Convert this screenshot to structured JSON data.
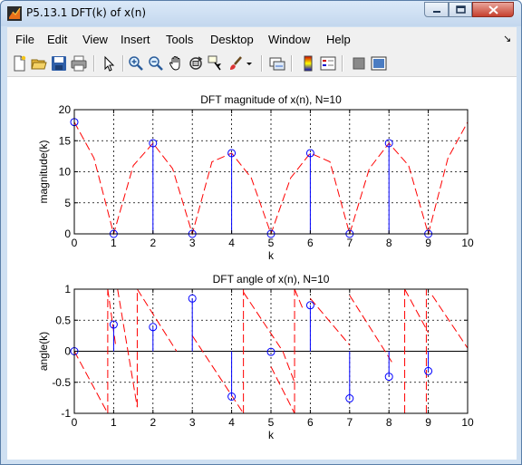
{
  "window": {
    "title": "P5.13.1 DFT(k) of x(n)",
    "menus": [
      "File",
      "Edit",
      "View",
      "Insert",
      "Tools",
      "Desktop",
      "Window",
      "Help"
    ],
    "dock_glyph": "↘"
  },
  "toolbar": {
    "icons": [
      "new-figure-icon",
      "open-file-icon",
      "save-icon",
      "print-icon",
      "edit-plot-arrow-icon",
      "zoom-in-icon",
      "zoom-out-icon",
      "pan-hand-icon",
      "rotate-3d-icon",
      "data-cursor-icon",
      "brush-icon",
      "brush-dropdown-icon",
      "link-plot-icon",
      "colorbar-icon",
      "legend-icon",
      "hide-plot-tools-icon",
      "show-plot-tools-icon"
    ]
  },
  "colors": {
    "stem": "#0000ff",
    "curve": "#ff0000",
    "grid": "#000000",
    "background": "#ffffff"
  },
  "chart_data": [
    {
      "type": "line",
      "title": "DFT magnitude of x(n), N=10",
      "xlabel": "k",
      "ylabel": "magnitude(k)",
      "xlim": [
        0,
        10
      ],
      "ylim": [
        0,
        20
      ],
      "xticks": [
        "0",
        "1",
        "2",
        "3",
        "4",
        "5",
        "6",
        "7",
        "8",
        "9",
        "10"
      ],
      "yticks": [
        "0",
        "5",
        "10",
        "15",
        "20"
      ],
      "grid": true,
      "series": [
        {
          "style": "stem",
          "color": "#0000ff",
          "marker": "circle",
          "x": [
            0,
            1,
            2,
            3,
            4,
            5,
            6,
            7,
            8,
            9
          ],
          "y": [
            18.0,
            0.0,
            14.6,
            0.0,
            13.0,
            0.0,
            13.0,
            0.0,
            14.6,
            0.0
          ]
        },
        {
          "style": "dashed",
          "color": "#ff0000",
          "x": [
            0,
            0.5,
            1,
            1.5,
            2,
            2.5,
            3,
            3.5,
            4,
            4.5,
            5,
            5.5,
            6,
            6.5,
            7,
            7.5,
            8,
            8.5,
            9,
            9.5,
            10
          ],
          "y": [
            18.0,
            12.2,
            0.0,
            11.0,
            14.6,
            10.5,
            0.0,
            11.6,
            13.0,
            9.0,
            0.0,
            9.0,
            13.0,
            11.6,
            0.0,
            10.5,
            14.6,
            11.0,
            0.0,
            12.2,
            18.0
          ]
        }
      ]
    },
    {
      "type": "line",
      "title": "DFT angle of x(n), N=10",
      "xlabel": "k",
      "ylabel": "angle(k)",
      "xlim": [
        0,
        10
      ],
      "ylim": [
        -1,
        1
      ],
      "xticks": [
        "0",
        "1",
        "2",
        "3",
        "4",
        "5",
        "6",
        "7",
        "8",
        "9",
        "10"
      ],
      "yticks": [
        "-1",
        "-0.5",
        "0",
        "0.5",
        "1"
      ],
      "grid": true,
      "series": [
        {
          "style": "stem",
          "color": "#0000ff",
          "marker": "circle",
          "x": [
            0,
            1,
            2,
            3,
            4,
            5,
            6,
            7,
            8,
            9
          ],
          "y": [
            0.0,
            0.43,
            0.39,
            0.85,
            -0.73,
            -0.01,
            0.74,
            -0.76,
            -0.41,
            -0.32
          ]
        },
        {
          "style": "dashed",
          "color": "#ff0000",
          "segments": [
            {
              "x": [
                0,
                0.85
              ],
              "y": [
                0.0,
                -1.0
              ]
            },
            {
              "x": [
                0.85,
                0.85
              ],
              "y": [
                -1.0,
                1.0
              ]
            },
            {
              "x": [
                0.85,
                1.05
              ],
              "y": [
                1.0,
                0.1
              ]
            },
            {
              "x": [
                1.1,
                1.6
              ],
              "y": [
                1.0,
                -0.9
              ]
            },
            {
              "x": [
                1.6,
                1.6
              ],
              "y": [
                -0.9,
                1.0
              ]
            },
            {
              "x": [
                1.6,
                2.6
              ],
              "y": [
                1.0,
                0.0
              ]
            },
            {
              "x": [
                3.0,
                4.3
              ],
              "y": [
                0.25,
                -1.0
              ]
            },
            {
              "x": [
                4.3,
                4.3
              ],
              "y": [
                -1.0,
                1.0
              ]
            },
            {
              "x": [
                4.3,
                5.3
              ],
              "y": [
                0.95,
                0.0
              ]
            },
            {
              "x": [
                5.3,
                5.6
              ],
              "y": [
                0.0,
                -0.5
              ]
            },
            {
              "x": [
                5.0,
                5.6
              ],
              "y": [
                -0.25,
                -1.0
              ]
            },
            {
              "x": [
                5.6,
                5.6
              ],
              "y": [
                -1.0,
                1.0
              ]
            },
            {
              "x": [
                5.6,
                5.8
              ],
              "y": [
                1.0,
                0.7
              ]
            },
            {
              "x": [
                6.0,
                7.0
              ],
              "y": [
                0.85,
                0.1
              ]
            },
            {
              "x": [
                7.0,
                8.1
              ],
              "y": [
                0.9,
                -0.2
              ]
            },
            {
              "x": [
                8.4,
                9.0
              ],
              "y": [
                1.0,
                0.3
              ]
            },
            {
              "x": [
                8.4,
                8.4
              ],
              "y": [
                -1.0,
                1.0
              ]
            },
            {
              "x": [
                8.95,
                8.95
              ],
              "y": [
                -1.0,
                1.0
              ]
            },
            {
              "x": [
                9.1,
                10.0
              ],
              "y": [
                0.9,
                0.05
              ]
            }
          ]
        }
      ]
    }
  ]
}
